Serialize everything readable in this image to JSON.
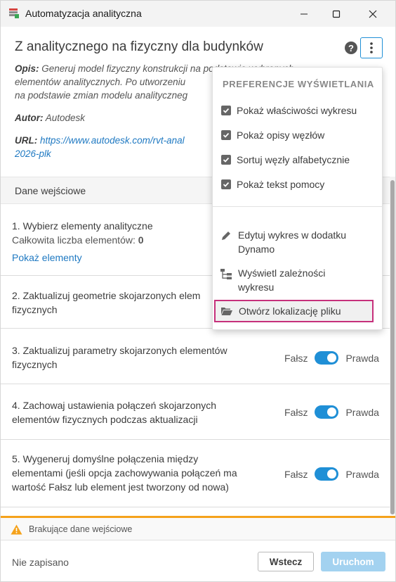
{
  "window": {
    "title": "Automatyzacja analityczna"
  },
  "header": {
    "title": "Z analitycznego na fizyczny dla budynków",
    "description_label": "Opis:",
    "description_lines": [
      "Generuj model fizyczny konstrukcji na podstawie wybranych",
      "elementów analitycznych. Po utworzeniu",
      "na podstawie zmian modelu analityczneg"
    ],
    "author_label": "Autor:",
    "author": "Autodesk",
    "url_label": "URL:",
    "url_line1": "https://www.autodesk.com/rvt-anal",
    "url_line2": "2026-plk"
  },
  "inputs": {
    "section_title": "Dane wejściowe",
    "item1": {
      "label": "1. Wybierz elementy analityczne",
      "count_label": "Całkowita liczba elementów:",
      "count": "0",
      "link": "Pokaż elementy"
    },
    "item2": {
      "label_line1": "2. Zaktualizuj geometrie skojarzonych elem",
      "label_line2": "fizycznych"
    },
    "item3": {
      "label_line1": "3. Zaktualizuj parametry skojarzonych elementów",
      "label_line2": "fizycznych",
      "false_label": "Fałsz",
      "true_label": "Prawda",
      "value": true
    },
    "item4": {
      "label_line1": "4. Zachowaj ustawienia połączeń skojarzonych",
      "label_line2": "elementów fizycznych podczas aktualizacji",
      "false_label": "Fałsz",
      "true_label": "Prawda",
      "value": true
    },
    "item5": {
      "label_line1": "5. Wygeneruj domyślne połączenia między",
      "label_line2": "elementami (jeśli opcja zachowywania połączeń ma",
      "label_line3": "wartość Fałsz lub element jest tworzony od nowa)",
      "false_label": "Fałsz",
      "true_label": "Prawda",
      "value": true
    }
  },
  "footer": {
    "warning": "Brakujące dane wejściowe",
    "status": "Nie zapisano",
    "back_label": "Wstecz",
    "run_label": "Uruchom"
  },
  "menu": {
    "heading": "PREFERENCJE WYŚWIETLANIA",
    "checks": [
      {
        "label": "Pokaż właściwości wykresu",
        "checked": true
      },
      {
        "label": "Pokaż opisy węzłów",
        "checked": true
      },
      {
        "label": "Sortuj węzły alfabetycznie",
        "checked": true
      },
      {
        "label": "Pokaż tekst pomocy",
        "checked": true
      }
    ],
    "actions": {
      "edit_line1": "Edytuj wykres w dodatku",
      "edit_line2": "Dynamo",
      "deps_line1": "Wyświetl zależności",
      "deps_line2": "wykresu",
      "open": "Otwórz lokalizację pliku"
    }
  },
  "colors": {
    "accent": "#1f8fd6",
    "warning": "#f5a21b",
    "highlight": "#c6307b",
    "link": "#1f79c2"
  }
}
